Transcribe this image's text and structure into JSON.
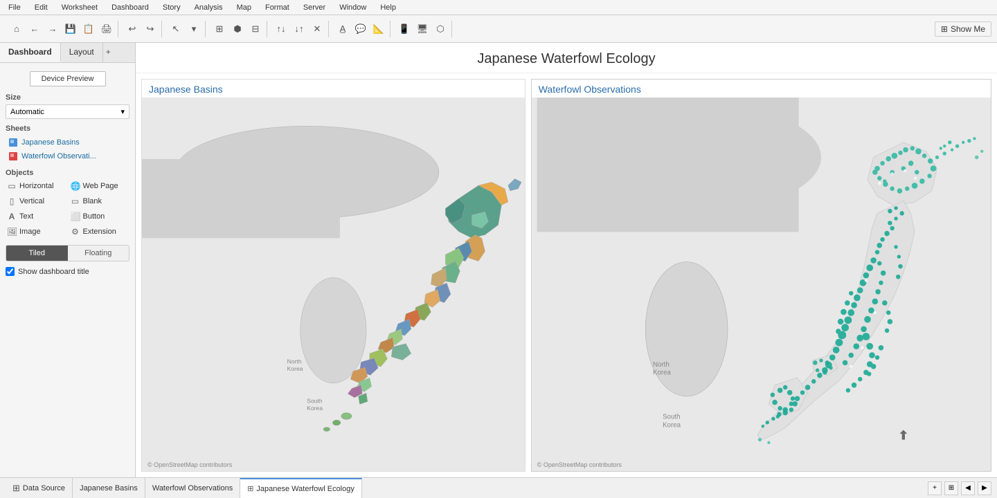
{
  "menubar": {
    "items": [
      "File",
      "Edit",
      "Worksheet",
      "Dashboard",
      "Story",
      "Analysis",
      "Map",
      "Format",
      "Server",
      "Window",
      "Help"
    ]
  },
  "toolbar": {
    "show_me_label": "Show Me"
  },
  "sidebar": {
    "tabs": {
      "dashboard_label": "Dashboard",
      "layout_label": "Layout"
    },
    "device_preview_label": "Device Preview",
    "size_section": "Size",
    "size_value": "Automatic",
    "sheets_section": "Sheets",
    "sheets": [
      {
        "label": "Japanese Basins"
      },
      {
        "label": "Waterfowl Observati..."
      }
    ],
    "objects_section": "Objects",
    "objects": [
      {
        "icon": "▭",
        "label": "Horizontal"
      },
      {
        "icon": "🌐",
        "label": "Web Page"
      },
      {
        "icon": "▯",
        "label": "Vertical"
      },
      {
        "icon": "▭",
        "label": "Blank"
      },
      {
        "icon": "A",
        "label": "Text"
      },
      {
        "icon": "⬜",
        "label": "Button"
      },
      {
        "icon": "🖼",
        "label": "Image"
      },
      {
        "icon": "⚙",
        "label": "Extension"
      }
    ],
    "layout_tiled": "Tiled",
    "layout_floating": "Floating",
    "show_title_label": "Show dashboard title"
  },
  "dashboard": {
    "title": "Japanese Waterfowl Ecology",
    "map_left": {
      "title": "Japanese Basins",
      "credit": "© OpenStreetMap contributors"
    },
    "map_right": {
      "title": "Waterfowl Observations",
      "credit": "© OpenStreetMap contributors"
    }
  },
  "statusbar": {
    "tabs": [
      {
        "icon": "⊞",
        "label": "Data Source"
      },
      {
        "label": "Japanese Basins"
      },
      {
        "label": "Waterfowl Observations"
      },
      {
        "icon": "⊞",
        "label": "Japanese Waterfowl Ecology",
        "active": true
      }
    ]
  }
}
